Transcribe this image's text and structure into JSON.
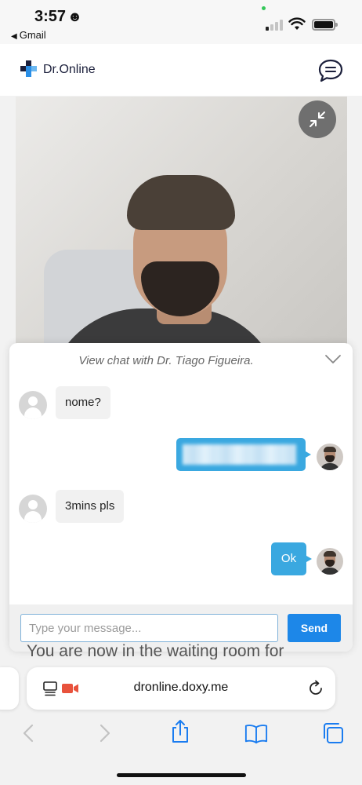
{
  "status_bar": {
    "time": "3:57",
    "time_emoji": "☻",
    "back_app_label": "Gmail",
    "back_arrow": "◀"
  },
  "app_header": {
    "brand_name": "Dr.Online",
    "chat_icon": "chat-bubble-icon"
  },
  "video": {
    "minimize_icon": "minimize-arrows-icon"
  },
  "chat": {
    "title": "View chat with Dr. Tiago Figueira.",
    "collapse_icon": "chevron-down-icon",
    "messages": [
      {
        "sender": "patient",
        "text": "nome?"
      },
      {
        "sender": "doctor",
        "text": ""
      },
      {
        "sender": "patient",
        "text": "3mins pls"
      },
      {
        "sender": "doctor",
        "text": "Ok"
      }
    ],
    "input_placeholder": "Type your message...",
    "input_value": "",
    "send_label": "Send"
  },
  "page_behind": {
    "waiting_text": "You are now in the waiting room for"
  },
  "browser": {
    "url": "dronline.doxy.me",
    "icons": [
      "page-menu-icon",
      "camera-recording-icon",
      "reload-icon",
      "back-icon",
      "forward-icon",
      "share-icon",
      "bookmarks-icon",
      "tabs-icon"
    ]
  },
  "colors": {
    "accent_blue": "#1d87e8",
    "bubble_blue": "#3aa8e0",
    "brand_dark": "#1b1f3b",
    "recording_red": "#e8523c",
    "safari_blue": "#1a7cf0"
  }
}
